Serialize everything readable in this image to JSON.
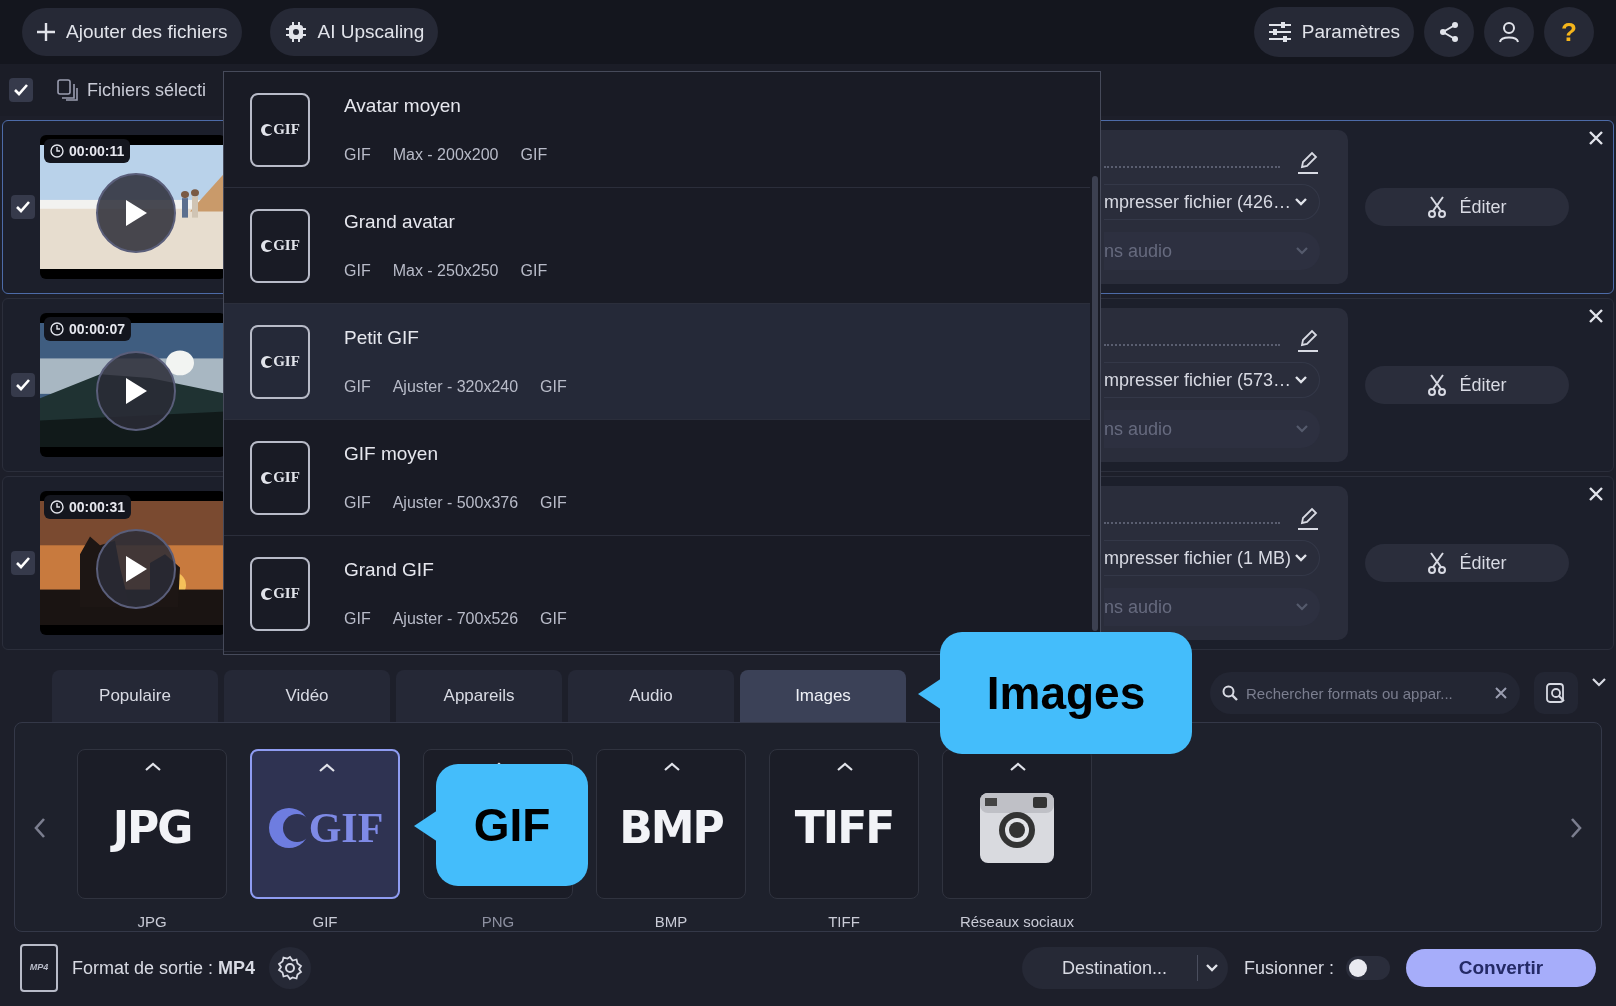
{
  "toolbar": {
    "add_files": "Ajouter des fichiers",
    "ai_upscaling": "AI Upscaling",
    "settings": "Paramètres",
    "help": "?"
  },
  "selection": {
    "checked": true,
    "label": "Fichiers sélecti"
  },
  "files": [
    {
      "checked": true,
      "selected": true,
      "duration": "00:00:11",
      "compression": "mpresser fichier (426…",
      "audio": "ns audio",
      "edit": "Éditer"
    },
    {
      "checked": true,
      "selected": false,
      "duration": "00:00:07",
      "compression": "mpresser fichier (573…",
      "audio": "ns audio",
      "edit": "Éditer"
    },
    {
      "checked": true,
      "selected": false,
      "duration": "00:00:31",
      "compression": "mpresser fichier (1 MB)",
      "audio": "ns audio",
      "edit": "Éditer"
    }
  ],
  "format_menu": {
    "items": [
      {
        "icon": "GIF",
        "title": "Avatar moyen",
        "format": "GIF",
        "size": "Max - 200x200",
        "codec": "GIF",
        "selected": false
      },
      {
        "icon": "GIF",
        "title": "Grand avatar",
        "format": "GIF",
        "size": "Max - 250x250",
        "codec": "GIF",
        "selected": false
      },
      {
        "icon": "GIF",
        "title": "Petit GIF",
        "format": "GIF",
        "size": "Ajuster - 320x240",
        "codec": "GIF",
        "selected": true
      },
      {
        "icon": "GIF",
        "title": "GIF moyen",
        "format": "GIF",
        "size": "Ajuster - 500x376",
        "codec": "GIF",
        "selected": false
      },
      {
        "icon": "GIF",
        "title": "Grand GIF",
        "format": "GIF",
        "size": "Ajuster - 700x526",
        "codec": "GIF",
        "selected": false
      }
    ]
  },
  "category_tabs": [
    {
      "label": "Populaire",
      "selected": false
    },
    {
      "label": "Vidéo",
      "selected": false
    },
    {
      "label": "Appareils",
      "selected": false
    },
    {
      "label": "Audio",
      "selected": false
    },
    {
      "label": "Images",
      "selected": true
    }
  ],
  "search": {
    "placeholder": "Rechercher formats ou appar..."
  },
  "formats": [
    {
      "kind": "text",
      "logo": "JPG",
      "label": "JPG",
      "selected": false
    },
    {
      "kind": "gif",
      "logo": "GIF",
      "label": "GIF",
      "selected": true
    },
    {
      "kind": "covered",
      "label": "PNG",
      "selected": false
    },
    {
      "kind": "text",
      "logo": "BMP",
      "label": "BMP",
      "selected": false
    },
    {
      "kind": "text",
      "logo": "TIFF",
      "label": "TIFF",
      "selected": false
    },
    {
      "kind": "camera",
      "label": "Réseaux sociaux",
      "selected": false
    }
  ],
  "callouts": [
    {
      "text": "Images"
    },
    {
      "text": "GIF"
    }
  ],
  "output": {
    "icon_text": "MP4",
    "label": "Format de sortie : **MP4**"
  },
  "destination": "Destination...",
  "merge": {
    "label": "Fusionner :",
    "on": false
  },
  "convert": "Convertir"
}
